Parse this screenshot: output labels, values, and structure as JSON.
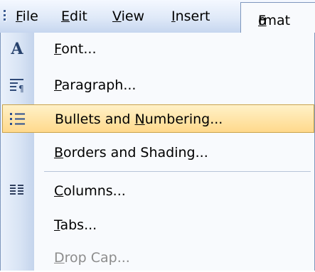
{
  "menubar": {
    "items": [
      {
        "label": "File"
      },
      {
        "label": "Edit"
      },
      {
        "label": "View"
      },
      {
        "label": "Insert"
      },
      {
        "label_pre": "F",
        "label_ul": "o",
        "label_post": "rmat"
      }
    ]
  },
  "dropdown": {
    "items": [
      {
        "pre": "",
        "ul": "F",
        "post": "ont...",
        "icon": "font-icon",
        "highlighted": false,
        "disabled": false
      },
      {
        "pre": "",
        "ul": "P",
        "post": "aragraph...",
        "icon": "paragraph-icon",
        "highlighted": false,
        "disabled": false
      },
      {
        "pre": "Bullets and ",
        "ul": "N",
        "post": "umbering...",
        "icon": "bullets-icon",
        "highlighted": true,
        "disabled": false
      },
      {
        "pre": "",
        "ul": "B",
        "post": "orders and Shading...",
        "icon": "",
        "highlighted": false,
        "disabled": false
      },
      {
        "pre": "",
        "ul": "C",
        "post": "olumns...",
        "icon": "columns-icon",
        "highlighted": false,
        "disabled": false
      },
      {
        "pre": "",
        "ul": "T",
        "post": "abs...",
        "icon": "",
        "highlighted": false,
        "disabled": false
      },
      {
        "pre": "",
        "ul": "D",
        "post": "rop Cap...",
        "icon": "",
        "highlighted": false,
        "disabled": true
      }
    ]
  },
  "colors": {
    "highlight": "#ffd98c",
    "menubar": "#dfe9f8",
    "disabled_text": "#8c8c8c"
  }
}
